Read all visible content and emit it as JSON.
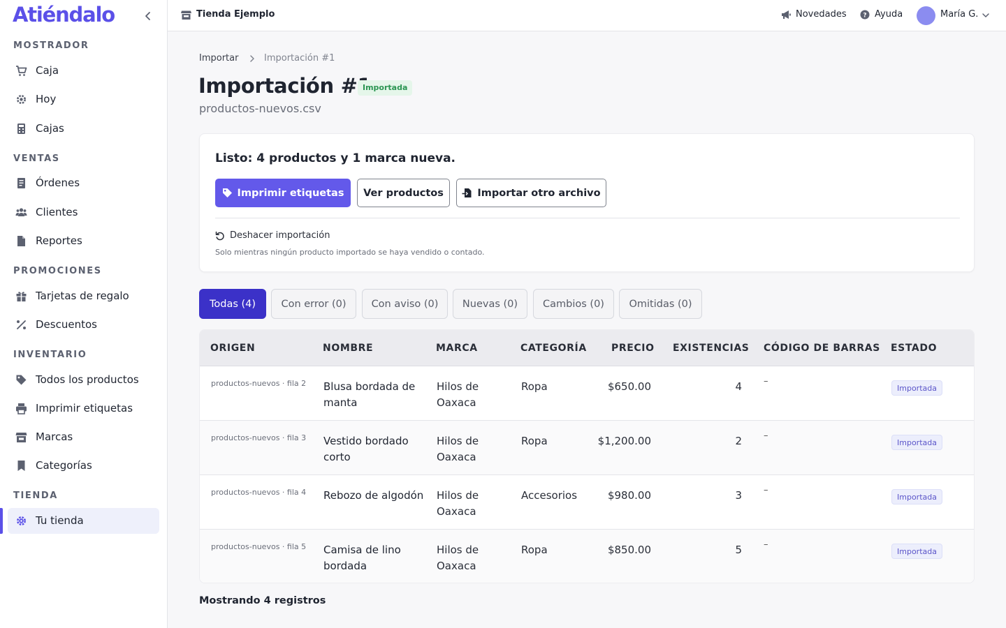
{
  "brand": "Atiéndalo",
  "sidebar": {
    "sections": [
      {
        "label": "MOSTRADOR",
        "items": [
          {
            "label": "Caja",
            "icon": "cart-icon"
          },
          {
            "label": "Hoy",
            "icon": "gear-icon"
          },
          {
            "label": "Cajas",
            "icon": "calculator-icon"
          }
        ]
      },
      {
        "label": "VENTAS",
        "items": [
          {
            "label": "Órdenes",
            "icon": "receipt-icon"
          },
          {
            "label": "Clientes",
            "icon": "users-icon"
          },
          {
            "label": "Reportes",
            "icon": "file-icon"
          }
        ]
      },
      {
        "label": "PROMOCIONES",
        "items": [
          {
            "label": "Tarjetas de regalo",
            "icon": "gift-icon"
          },
          {
            "label": "Descuentos",
            "icon": "percent-icon"
          }
        ]
      },
      {
        "label": "INVENTARIO",
        "items": [
          {
            "label": "Todos los productos",
            "icon": "tag-icon"
          },
          {
            "label": "Imprimir etiquetas",
            "icon": "printer-icon"
          },
          {
            "label": "Marcas",
            "icon": "store-icon"
          },
          {
            "label": "Categorías",
            "icon": "bookmark-icon"
          }
        ]
      },
      {
        "label": "TIENDA",
        "items": [
          {
            "label": "Tu tienda",
            "icon": "settings-icon",
            "active": true
          }
        ]
      }
    ]
  },
  "topbar": {
    "store_name": "Tienda Ejemplo",
    "news": "Novedades",
    "help": "Ayuda",
    "user": "María G."
  },
  "breadcrumb": {
    "parent": "Importar",
    "current": "Importación #1"
  },
  "page": {
    "title": "Importación #1",
    "badge": "Importada",
    "filename": "productos-nuevos.csv"
  },
  "summary": {
    "message": "Listo: 4 productos y 1 marca nueva.",
    "print_labels": "Imprimir etiquetas",
    "view_products": "Ver productos",
    "import_other": "Importar otro archivo",
    "undo": "Deshacer importación",
    "undo_note": "Solo mientras ningún producto importado se haya vendido o contado."
  },
  "tabs": [
    {
      "label": "Todas (4)",
      "active": true
    },
    {
      "label": "Con error (0)"
    },
    {
      "label": "Con aviso (0)"
    },
    {
      "label": "Nuevas (0)"
    },
    {
      "label": "Cambios (0)"
    },
    {
      "label": "Omitidas (0)"
    }
  ],
  "table": {
    "headers": [
      "ORIGEN",
      "NOMBRE",
      "MARCA",
      "CATEGORÍA",
      "PRECIO",
      "EXISTENCIAS",
      "CÓDIGO DE BARRAS",
      "ESTADO"
    ],
    "rows": [
      {
        "origin": "productos-nuevos · fila 2",
        "name": "Blusa bordada de manta",
        "brand": "Hilos de Oaxaca",
        "category": "Ropa",
        "price": "$650.00",
        "stock": "4",
        "barcode": "–",
        "status": "Importada"
      },
      {
        "origin": "productos-nuevos · fila 3",
        "name": "Vestido bordado corto",
        "brand": "Hilos de Oaxaca",
        "category": "Ropa",
        "price": "$1,200.00",
        "stock": "2",
        "barcode": "–",
        "status": "Importada"
      },
      {
        "origin": "productos-nuevos · fila 4",
        "name": "Rebozo de algodón",
        "brand": "Hilos de Oaxaca",
        "category": "Accesorios",
        "price": "$980.00",
        "stock": "3",
        "barcode": "–",
        "status": "Importada"
      },
      {
        "origin": "productos-nuevos · fila 5",
        "name": "Camisa de lino bordada",
        "brand": "Hilos de Oaxaca",
        "category": "Ropa",
        "price": "$850.00",
        "stock": "5",
        "barcode": "–",
        "status": "Importada"
      }
    ]
  },
  "footer": {
    "count": "Mostrando 4 registros"
  },
  "colors": {
    "accent": "#6359ea",
    "tab_active": "#3b31c8",
    "success_bg": "#e5f6ea",
    "success_text": "#2b9552"
  }
}
